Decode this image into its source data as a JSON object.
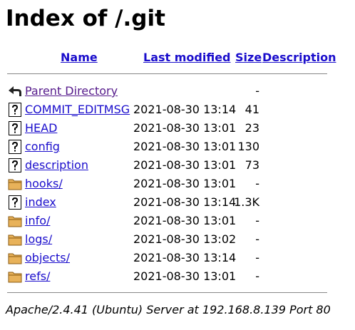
{
  "page": {
    "title": "Index of /.git"
  },
  "columns": {
    "name": "Name",
    "last_modified": "Last modified",
    "size": "Size",
    "description": "Description"
  },
  "rows": [
    {
      "icon": "back-arrow-icon",
      "name": "Parent Directory",
      "modified": "",
      "size": "-"
    },
    {
      "icon": "unknown-file-icon",
      "name": "COMMIT_EDITMSG",
      "modified": "2021-08-30 13:14",
      "size": "41"
    },
    {
      "icon": "unknown-file-icon",
      "name": "HEAD",
      "modified": "2021-08-30 13:01",
      "size": "23"
    },
    {
      "icon": "unknown-file-icon",
      "name": "config",
      "modified": "2021-08-30 13:01",
      "size": "130"
    },
    {
      "icon": "unknown-file-icon",
      "name": "description",
      "modified": "2021-08-30 13:01",
      "size": "73"
    },
    {
      "icon": "folder-icon",
      "name": "hooks/",
      "modified": "2021-08-30 13:01",
      "size": "-"
    },
    {
      "icon": "unknown-file-icon",
      "name": "index",
      "modified": "2021-08-30 13:14",
      "size": "1.3K"
    },
    {
      "icon": "folder-icon",
      "name": "info/",
      "modified": "2021-08-30 13:01",
      "size": "-"
    },
    {
      "icon": "folder-icon",
      "name": "logs/",
      "modified": "2021-08-30 13:02",
      "size": "-"
    },
    {
      "icon": "folder-icon",
      "name": "objects/",
      "modified": "2021-08-30 13:14",
      "size": "-"
    },
    {
      "icon": "folder-icon",
      "name": "refs/",
      "modified": "2021-08-30 13:01",
      "size": "-"
    }
  ],
  "footer": {
    "address": "Apache/2.4.41 (Ubuntu) Server at 192.168.8.139 Port 80"
  },
  "colors": {
    "link": "#1a0dcc",
    "visited_link": "#551a8b",
    "rule": "#888888",
    "folder": "#e8b25a"
  }
}
